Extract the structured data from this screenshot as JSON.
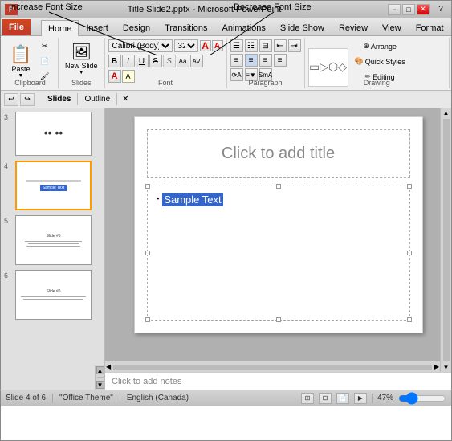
{
  "window": {
    "title": "Title Slide2.pptx - Microsoft PowerPoint",
    "pp_icon": "P",
    "min_btn": "−",
    "max_btn": "□",
    "close_btn": "✕",
    "help_btn": "?"
  },
  "annotation": {
    "increase_label": "Increase Font Size",
    "decrease_label": "Decrease Font Size"
  },
  "tabs": {
    "file": "File",
    "home": "Home",
    "insert": "Insert",
    "design": "Design",
    "transitions": "Transitions",
    "animations": "Animations",
    "slide_show": "Slide Show",
    "review": "Review",
    "view": "View",
    "format": "Format"
  },
  "ribbon": {
    "clipboard": {
      "label": "Clipboard",
      "paste": "Paste",
      "new_slide": "New Slide"
    },
    "font": {
      "label": "Font",
      "font_name": "Calibri (Body)",
      "font_size": "32",
      "bold": "B",
      "italic": "I",
      "underline": "U",
      "strikethrough": "S",
      "shadow": "S",
      "increase_font": "A",
      "decrease_font": "A",
      "font_color": "A",
      "clear": "Aa"
    },
    "paragraph": {
      "label": "Paragraph",
      "align_left": "≡",
      "align_center": "≡",
      "align_right": "≡",
      "bullets": "☰",
      "numbering": "☰"
    },
    "drawing": {
      "label": "Drawing",
      "shapes": "Shapes",
      "arrange": "Arrange",
      "quick_styles": "Quick Styles",
      "editing": "Editing"
    }
  },
  "view_bar": {
    "slides_tab": "Slides",
    "outline_tab": "Outline",
    "close": "✕"
  },
  "slides": [
    {
      "number": "3",
      "content": "••",
      "active": false
    },
    {
      "number": "4",
      "content": "Sample Text",
      "active": true
    },
    {
      "number": "5",
      "content": "Slide #5",
      "active": false
    },
    {
      "number": "6",
      "content": "Slide #6",
      "active": false
    }
  ],
  "slide_content": {
    "title_placeholder": "Click to add title",
    "sample_text": "Sample Text",
    "content_placeholder": "Click to add notes"
  },
  "status_bar": {
    "slide_info": "Slide 4 of 6",
    "theme": "\"Office Theme\"",
    "language": "English (Canada)",
    "zoom": "47%"
  }
}
